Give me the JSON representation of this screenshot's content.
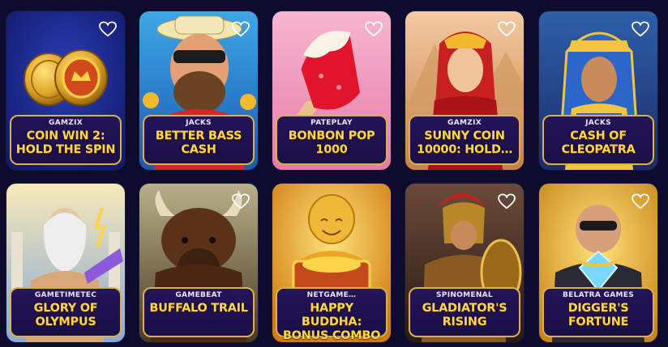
{
  "games": [
    {
      "provider": "GAMZIX",
      "title": "COIN WIN 2: HOLD THE SPIN",
      "icon": "heart-outline-icon"
    },
    {
      "provider": "JACKS",
      "title": "BETTER BASS CASH",
      "icon": "heart-outline-icon"
    },
    {
      "provider": "PATEPLAY",
      "title": "BONBON POP 1000",
      "icon": "heart-outline-icon"
    },
    {
      "provider": "GAMZIX",
      "title": "SUNNY COIN 10000: HOLD…",
      "icon": "heart-outline-icon"
    },
    {
      "provider": "JACKS",
      "title": "CASH OF CLEOPATRA",
      "icon": "heart-outline-icon"
    },
    {
      "provider": "GAMETIMETEC",
      "title": "GLORY OF OLYMPUS",
      "icon": "heart-outline-icon"
    },
    {
      "provider": "GAMEBEAT",
      "title": "BUFFALO TRAIL",
      "icon": "heart-outline-icon"
    },
    {
      "provider": "NETGAME…",
      "title": "HAPPY BUDDHA: BONUS COMBO",
      "icon": "heart-outline-icon"
    },
    {
      "provider": "SPINOMENAL",
      "title": "GLADIATOR'S RISING",
      "icon": "heart-outline-icon"
    },
    {
      "provider": "BELATRA GAMES",
      "title": "DIGGER'S FORTUNE",
      "icon": "heart-outline-icon"
    }
  ],
  "colors": {
    "background": "#0d0b2e",
    "caption_border": "#d8b24a",
    "title_text": "#ffd34a"
  }
}
